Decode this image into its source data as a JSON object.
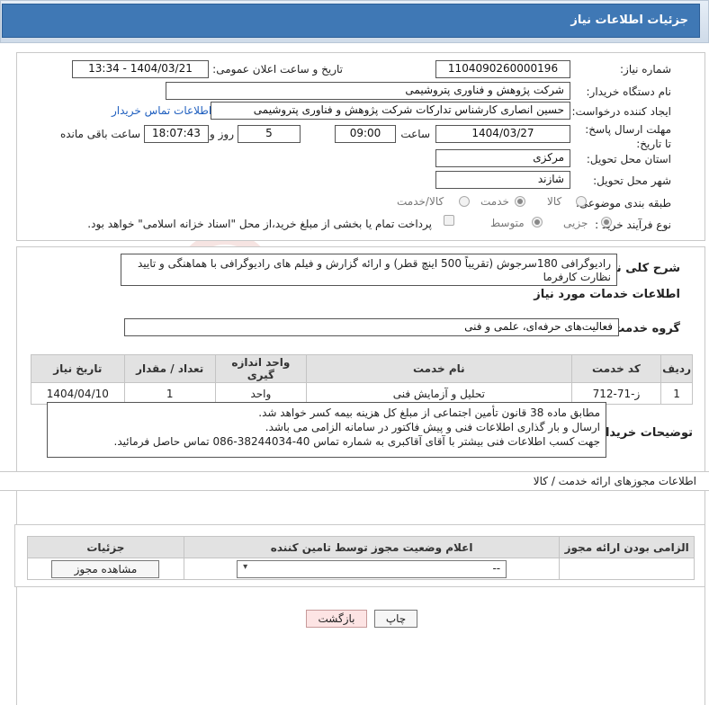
{
  "header": {
    "title": "جزئیات اطلاعات نیاز"
  },
  "form": {
    "need_number_label": "شماره نیاز:",
    "need_number": "1104090260000196",
    "announce_label": "تاریخ و ساعت اعلان عمومی:",
    "announce_value": "1404/03/21 - 13:34",
    "buyer_org_label": "نام دستگاه خریدار:",
    "buyer_org": "شرکت پژوهش و فناوری پتروشیمی",
    "creator_label": "ایجاد کننده درخواست:",
    "creator": "حسین انصاری کارشناس تدارکات شرکت پژوهش و فناوری پتروشیمی",
    "buyer_contact_link": "اطلاعات تماس خریدار",
    "deadline_label": "مهلت ارسال پاسخ: تا تاریخ:",
    "deadline_date": "1404/03/27",
    "time_label": "ساعت",
    "deadline_time": "09:00",
    "days_value": "5",
    "days_label": "روز و",
    "remaining_time": "18:07:43",
    "remaining_label": "ساعت باقی مانده",
    "province_label": "استان محل تحویل:",
    "province": "مرکزی",
    "city_label": "شهر محل تحویل:",
    "city": "شازند",
    "category_label": "طبقه بندی موضوعی:",
    "category_options": [
      "کالا",
      "خدمت",
      "کالا/خدمت"
    ],
    "category_selected": "خدمت",
    "process_label": "نوع فرآیند خرید :",
    "process_options": [
      "جزیی",
      "متوسط"
    ],
    "process_selected": "جزیی",
    "payment_note": "پرداخت تمام یا بخشی از مبلغ خرید،از محل \"اسناد خزانه اسلامی\" خواهد بود."
  },
  "description": {
    "label": "شرح کلی نیاز:",
    "text": "رادیوگرافی 180سرجوش (تقریباً 500 اینچ قطر) و ارائه گزارش و فیلم های رادیوگرافی با هماهنگی و تایید نظارت کارفرما"
  },
  "services": {
    "title": "اطلاعات خدمات مورد نیاز",
    "group_label": "گروه خدمت:",
    "group_value": "فعالیت‌های حرفه‌ای، علمی و فنی",
    "columns": [
      "ردیف",
      "کد خدمت",
      "نام خدمت",
      "واحد اندازه گیری",
      "تعداد / مقدار",
      "تاریخ نیاز"
    ],
    "rows": [
      {
        "row": "1",
        "code": "ز-71-712",
        "name": "تحلیل و آزمایش فنی",
        "unit": "واحد",
        "qty": "1",
        "date": "1404/04/10"
      }
    ]
  },
  "buyer_notes": {
    "label": "توضیحات خریدار:",
    "lines": [
      "مطابق ماده 38 قانون تأمین اجتماعی از مبلغ کل هزینه بیمه کسر خواهد شد.",
      "ارسال و بار گذاری اطلاعات فنی و پیش فاکتور در سامانه الزامی می باشد.",
      "جهت کسب اطلاعات فنی بیشتر با آقای آقاکبری به شماره تماس  40-38244034-086 تماس حاصل فرمائید."
    ]
  },
  "permits": {
    "title": "اطلاعات مجوزهای ارائه خدمت / کالا",
    "columns": [
      "الزامی بودن ارائه مجوز",
      "اعلام وضعیت مجوز توسط تامین کننده",
      "جزئیات"
    ],
    "select_value": "--",
    "view_button": "مشاهده مجوز"
  },
  "footer": {
    "print_button": "چاپ",
    "back_button": "بازگشت"
  },
  "watermark": {
    "text": "AriaTender.neT"
  },
  "colors": {
    "header": "#3f78b5",
    "link": "#1f5fbf",
    "watermark": "#c0392b"
  }
}
